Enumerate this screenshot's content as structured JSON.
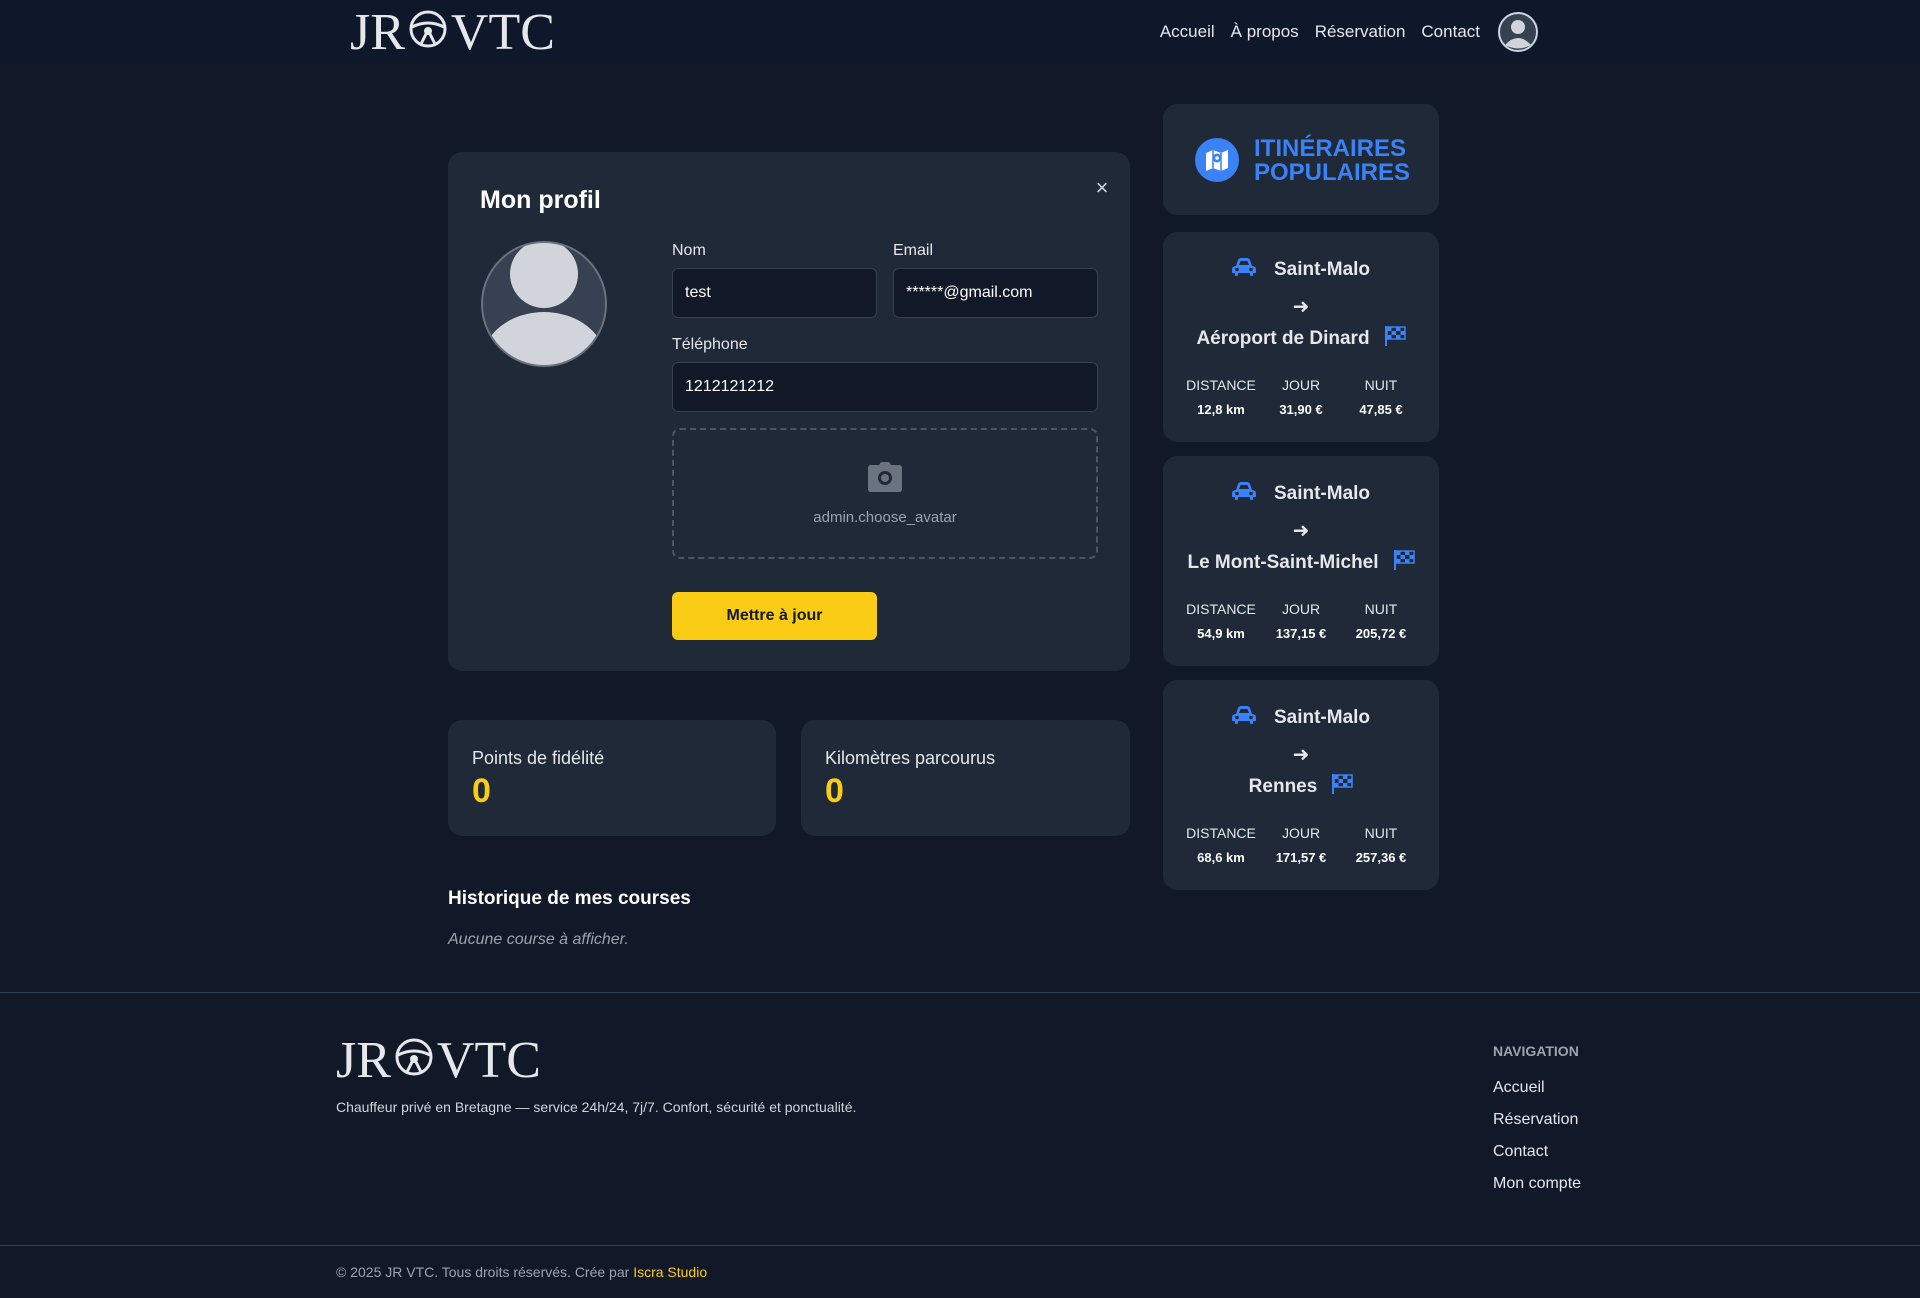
{
  "brand": {
    "logo_left": "JR",
    "logo_right": "VTC"
  },
  "header": {
    "nav": [
      "Accueil",
      "À propos",
      "Réservation",
      "Contact"
    ]
  },
  "profile": {
    "title": "Mon profil",
    "close_label": "×",
    "fields": {
      "name_label": "Nom",
      "name_value": "test",
      "email_label": "Email",
      "email_value": "******@gmail.com",
      "phone_label": "Téléphone",
      "phone_value": "1212121212"
    },
    "avatar_upload_label": "admin.choose_avatar",
    "update_button": "Mettre à jour"
  },
  "stats": {
    "loyalty_label": "Points de fidélité",
    "loyalty_value": "0",
    "km_label": "Kilomètres parcourus",
    "km_value": "0"
  },
  "history": {
    "title": "Historique de mes courses",
    "empty": "Aucune course à afficher."
  },
  "routes": {
    "title_line1": "ITINÉRAIRES",
    "title_line2": "POPULAIRES",
    "arrow": "➜",
    "stat_labels": {
      "distance": "DISTANCE",
      "day": "JOUR",
      "night": "NUIT"
    },
    "items": [
      {
        "from": "Saint-Malo",
        "to": "Aéroport de Dinard",
        "distance": "12,8 km",
        "day": "31,90 €",
        "night": "47,85 €"
      },
      {
        "from": "Saint-Malo",
        "to": "Le Mont-Saint-Michel",
        "distance": "54,9 km",
        "day": "137,15 €",
        "night": "205,72 €"
      },
      {
        "from": "Saint-Malo",
        "to": "Rennes",
        "distance": "68,6 km",
        "day": "171,57 €",
        "night": "257,36 €"
      }
    ]
  },
  "footer": {
    "tagline": "Chauffeur privé en Bretagne — service 24h/24, 7j/7. Confort, sécurité et ponctualité.",
    "nav_title": "NAVIGATION",
    "links": [
      "Accueil",
      "Réservation",
      "Contact",
      "Mon compte"
    ],
    "copyright": "© 2025 JR VTC. Tous droits réservés. Crée par",
    "studio": "Iscra Studio"
  },
  "colors": {
    "background": "#111827",
    "card": "#1f2937",
    "accent_yellow": "#facc15",
    "accent_blue": "#3b82f6"
  }
}
